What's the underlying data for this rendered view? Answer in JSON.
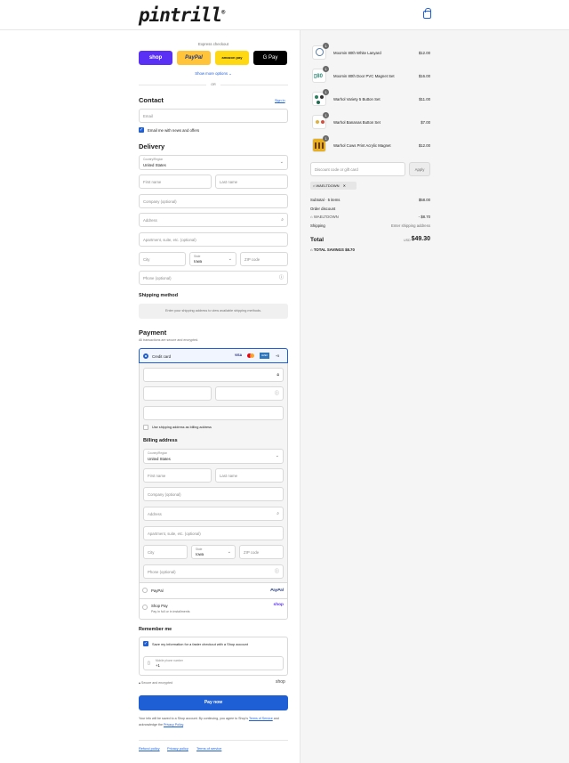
{
  "header": {
    "logo": "pintrill",
    "logo_mark": "®"
  },
  "express": {
    "title": "Express checkout",
    "shop": "shop",
    "paypal": "PayPal",
    "amazon": "amazon pay",
    "gpay": "G Pay",
    "more": "Show more options ⌄",
    "or": "OR"
  },
  "contact": {
    "title": "Contact",
    "signin": "Sign in",
    "email_placeholder": "Email",
    "news_label": "Email me with news and offers"
  },
  "delivery": {
    "title": "Delivery",
    "country_label": "Country/Region",
    "country_value": "United States",
    "first_name": "First name",
    "last_name": "Last name",
    "company": "Company (optional)",
    "address": "Address",
    "apartment": "Apartment, suite, etc. (optional)",
    "city": "City",
    "state_label": "State",
    "state_value": "Iowa",
    "zip": "ZIP code",
    "phone": "Phone (optional)"
  },
  "shipping_method": {
    "title": "Shipping method",
    "note": "Enter your shipping address to view available shipping methods."
  },
  "payment": {
    "title": "Payment",
    "subtitle": "All transactions are secure and encrypted.",
    "credit_card": "Credit card",
    "visa": "VISA",
    "amex": "AMEX",
    "more_cards": "+5",
    "use_shipping": "Use shipping address as billing address",
    "billing_title": "Billing address",
    "paypal": "PayPal",
    "paypal_logo": "PayPal",
    "shop_pay": "Shop Pay",
    "shop_pay_sub": "Pay in full or in installments",
    "shop_logo": "shop"
  },
  "remember": {
    "title": "Remember me",
    "save_label": "Save my information for a faster checkout with a Shop account",
    "phone_label": "Mobile phone number",
    "phone_value": "+1",
    "secure": "Secure and encrypted",
    "shop": "shop"
  },
  "pay_now": "Pay now",
  "legal": {
    "text1": "Your info will be saved to a Shop account. By continuing, you agree to Shop's",
    "tos": "Terms of Service",
    "text2": "and acknowledge the",
    "privacy": "Privacy Policy",
    "period": "."
  },
  "footer": [
    "Refund policy",
    "Privacy policy",
    "Terms of service"
  ],
  "cart": {
    "items": [
      {
        "name": "Moomin 80th White Lanyard",
        "price": "$12.00",
        "qty": "1"
      },
      {
        "name": "Moomin 80th Door PVC Magnet Set",
        "price": "$16.00",
        "qty": "1"
      },
      {
        "name": "Warhol Variety 5 Button Set",
        "price": "$11.00",
        "qty": "1"
      },
      {
        "name": "Warhol Bananas Button Set",
        "price": "$7.00",
        "qty": "1"
      },
      {
        "name": "Warhol Cows Print Acrylic Magnet",
        "price": "$12.00",
        "qty": "1"
      }
    ],
    "discount_placeholder": "Discount code or gift card",
    "apply": "Apply",
    "code_tag": "WAELTDOWN",
    "subtotal_label": "Subtotal · 5 items",
    "subtotal": "$58.00",
    "order_discount": "Order discount",
    "discount_code": "WAELTDOWN",
    "discount_value": "- $8.70",
    "shipping_label": "Shipping",
    "shipping_value": "Enter shipping address",
    "total_label": "Total",
    "currency": "USD",
    "total": "$49.30",
    "savings_label": "TOTAL SAVINGS",
    "savings": "$8.70"
  },
  "colors": {
    "accent": "#1f5fd6",
    "shop_purple": "#5a31f4",
    "paypal_yellow": "#ffc439",
    "amazon_yellow": "#ffd814"
  }
}
